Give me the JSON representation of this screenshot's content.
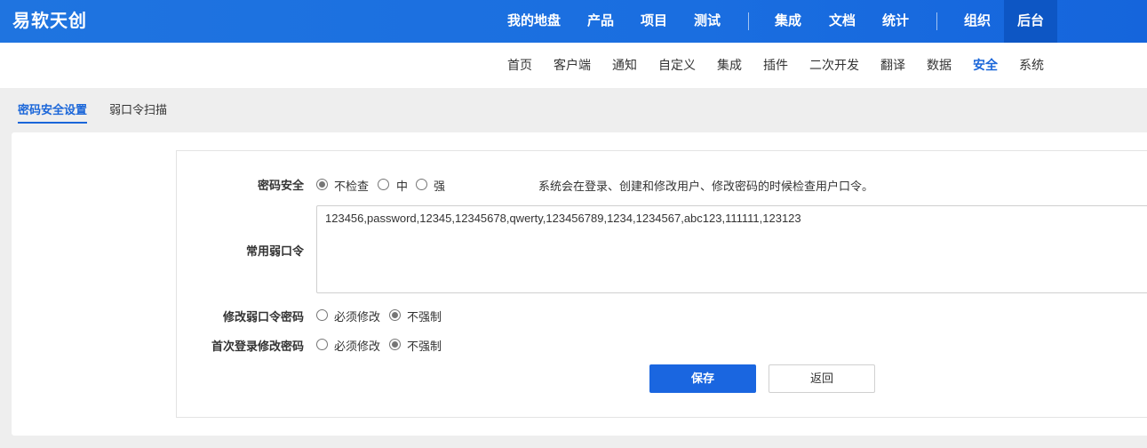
{
  "brand": "易软天创",
  "topnav": {
    "items": [
      "我的地盘",
      "产品",
      "项目",
      "测试",
      "集成",
      "文档",
      "统计",
      "组织",
      "后台"
    ],
    "active": "后台"
  },
  "subnav": {
    "items": [
      "首页",
      "客户端",
      "通知",
      "自定义",
      "集成",
      "插件",
      "二次开发",
      "翻译",
      "数据",
      "安全",
      "系统"
    ],
    "active": "安全"
  },
  "tabs": {
    "password_security": "密码安全设置",
    "weak_scan": "弱口令扫描"
  },
  "form": {
    "password_security": {
      "label": "密码安全",
      "options": [
        "不检查",
        "中",
        "强"
      ],
      "selected": "不检查",
      "hint": "系统会在登录、创建和修改用户、修改密码的时候检查用户口令。"
    },
    "weak_passwords": {
      "label": "常用弱口令",
      "value": "123456,password,12345,12345678,qwerty,123456789,1234,1234567,abc123,111111,123123"
    },
    "change_weak": {
      "label": "修改弱口令密码",
      "options": [
        "必须修改",
        "不强制"
      ],
      "selected": "不强制"
    },
    "first_login": {
      "label": "首次登录修改密码",
      "options": [
        "必须修改",
        "不强制"
      ],
      "selected": "不强制"
    },
    "save_label": "保存",
    "back_label": "返回"
  },
  "colors": {
    "primary": "#1a66e0",
    "topbar": "#1a6ee0",
    "topbar_active": "#0d56c4"
  }
}
